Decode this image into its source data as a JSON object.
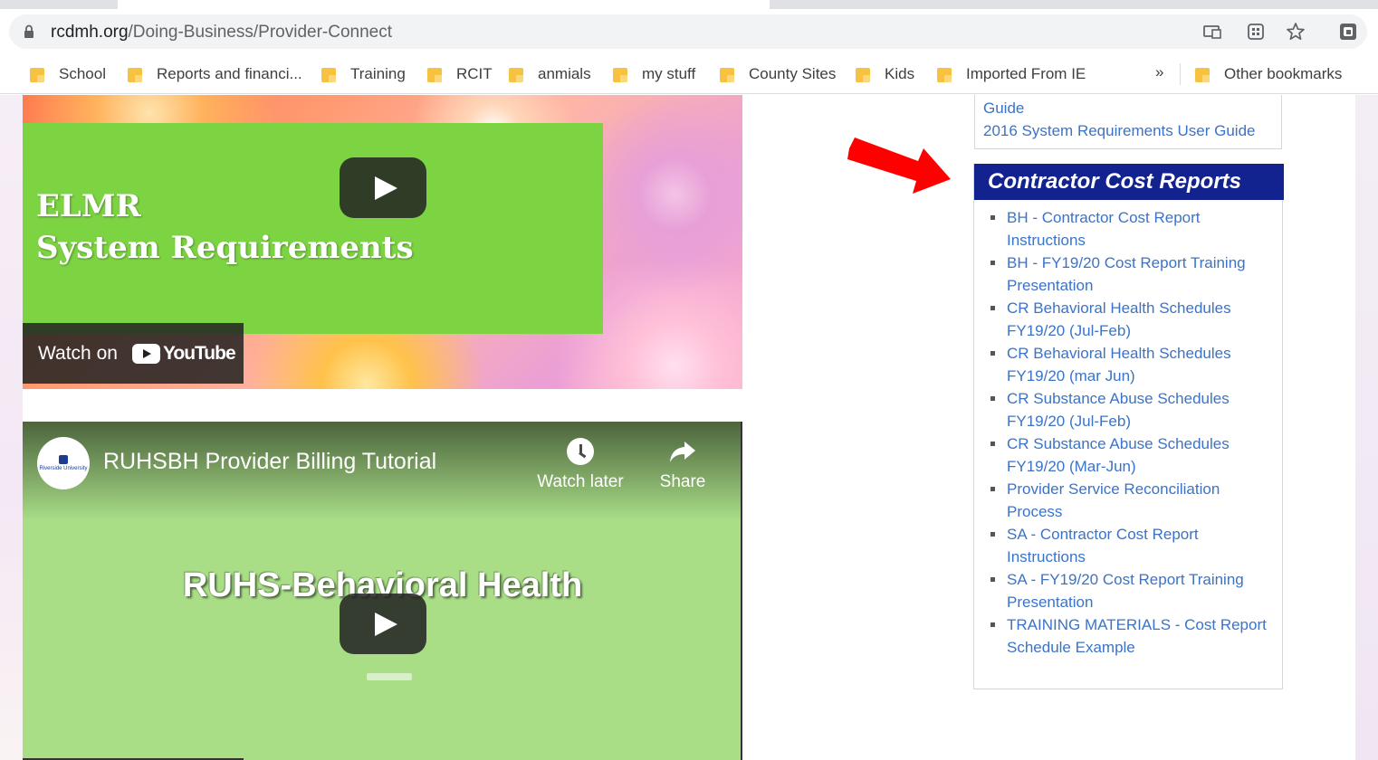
{
  "browser": {
    "url_host": "rcdmh.org",
    "url_path": "/Doing-Business/Provider-Connect",
    "bookmarks": [
      "School",
      "Reports and financi...",
      "Training",
      "RCIT",
      "anmials",
      "my stuff",
      "County Sites",
      "Kids",
      "Imported From IE"
    ],
    "overflow_chevron": "»",
    "other_bookmarks": "Other bookmarks"
  },
  "video1": {
    "title_line1": "ELMR",
    "title_line2": "System Requirements",
    "watch_on": "Watch on",
    "youtube": "YouTube"
  },
  "video2": {
    "channel_logo_text": "Riverside University",
    "title": "RUHSBH Provider Billing Tutorial",
    "watch_later": "Watch later",
    "share": "Share",
    "heading": "RUHS-Behavioral Health"
  },
  "sidebar": {
    "top_links": [
      "Guide",
      "2016 System Requirements User Guide"
    ],
    "panel_title": "Contractor Cost Reports",
    "items": [
      "BH - Contractor Cost Report Instructions",
      "BH - FY19/20 Cost Report Training Presentation",
      "CR Behavioral Health Schedules FY19/20 (Jul-Feb)",
      "CR Behavioral Health Schedules FY19/20 (mar Jun)",
      "CR Substance Abuse Schedules FY19/20 (Jul-Feb)",
      "CR Substance Abuse Schedules FY19/20 (Mar-Jun)",
      "Provider Service Reconciliation Process",
      "SA - Contractor Cost Report Instructions",
      "SA - FY19/20 Cost Report Training Presentation",
      "TRAINING MATERIALS - Cost Report Schedule Example"
    ]
  },
  "colors": {
    "panel_header_bg": "#12238f",
    "link": "#3b73c8",
    "arrow": "#ff0000",
    "video1_green": "#7dd442",
    "video2_green": "#a9de87"
  }
}
